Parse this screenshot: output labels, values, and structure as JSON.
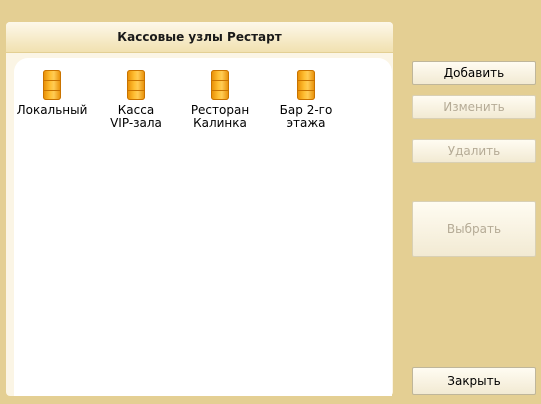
{
  "panel": {
    "title": "Кассовые узлы Рестарт",
    "nodes": [
      {
        "label": "Локальный",
        "icon": "database-icon"
      },
      {
        "label": "Касса\nVIP-зала",
        "icon": "database-icon"
      },
      {
        "label": "Ресторан\nКалинка",
        "icon": "database-icon"
      },
      {
        "label": "Бар 2-го\nэтажа",
        "icon": "database-icon"
      }
    ]
  },
  "buttons": {
    "add": "Добавить",
    "edit": "Изменить",
    "delete": "Удалить",
    "select": "Выбрать",
    "close": "Закрыть"
  },
  "colors": {
    "window_bg": "#e4cf93",
    "panel_bg": "#fbf5e5",
    "node_icon": "#ffbf33",
    "disabled_text": "#b5ab96"
  }
}
